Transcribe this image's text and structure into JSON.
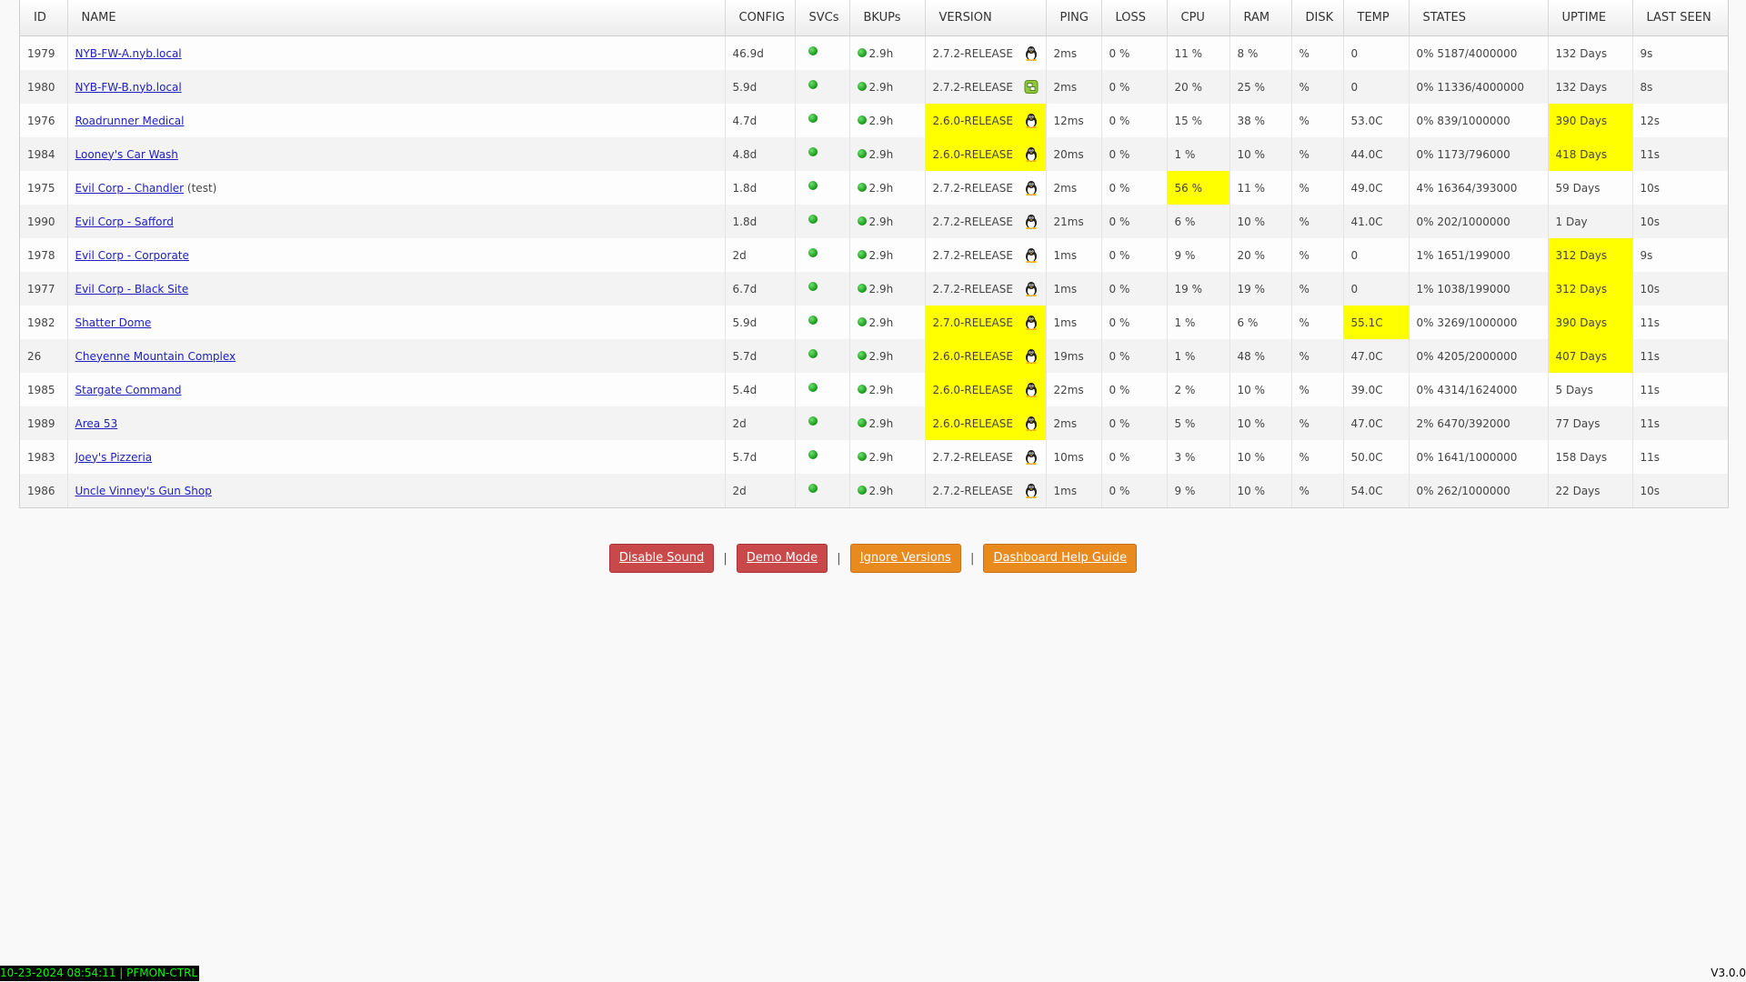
{
  "columns": [
    "ID",
    "NAME",
    "CONFIG",
    "SVCs",
    "BKUPs",
    "VERSION",
    "PING",
    "LOSS",
    "CPU",
    "RAM",
    "DISK",
    "TEMP",
    "STATES",
    "UPTIME",
    "LAST SEEN"
  ],
  "rows": [
    {
      "id": "1979",
      "name": "NYB-FW-A.nyb.local",
      "note": "",
      "config": "46.9d",
      "bkup": "2.9h",
      "version": "2.7.2-RELEASE",
      "os_icon": "tux-icon",
      "ping": "2ms",
      "loss": "0 %",
      "cpu": "11 %",
      "ram": "8 %",
      "disk": "%",
      "temp": "0",
      "states": "0% 5187/4000000",
      "uptime": "132 Days",
      "last_seen": "9s",
      "hl": {
        "version": false,
        "cpu": false,
        "temp": false,
        "uptime": false
      }
    },
    {
      "id": "1980",
      "name": "NYB-FW-B.nyb.local",
      "note": "",
      "config": "5.9d",
      "bkup": "2.9h",
      "version": "2.7.2-RELEASE",
      "os_icon": "failover-icon",
      "ping": "2ms",
      "loss": "0 %",
      "cpu": "20 %",
      "ram": "25 %",
      "disk": "%",
      "temp": "0",
      "states": "0% 11336/4000000",
      "uptime": "132 Days",
      "last_seen": "8s",
      "hl": {
        "version": false,
        "cpu": false,
        "temp": false,
        "uptime": false
      }
    },
    {
      "id": "1976",
      "name": "Roadrunner Medical",
      "note": "",
      "config": "4.7d",
      "bkup": "2.9h",
      "version": "2.6.0-RELEASE",
      "os_icon": "tux-icon",
      "ping": "12ms",
      "loss": "0 %",
      "cpu": "15 %",
      "ram": "38 %",
      "disk": "%",
      "temp": "53.0C",
      "states": "0% 839/1000000",
      "uptime": "390 Days",
      "last_seen": "12s",
      "hl": {
        "version": true,
        "cpu": false,
        "temp": false,
        "uptime": true
      }
    },
    {
      "id": "1984",
      "name": "Looney's Car Wash",
      "note": "",
      "config": "4.8d",
      "bkup": "2.9h",
      "version": "2.6.0-RELEASE",
      "os_icon": "tux-icon",
      "ping": "20ms",
      "loss": "0 %",
      "cpu": "1 %",
      "ram": "10 %",
      "disk": "%",
      "temp": "44.0C",
      "states": "0% 1173/796000",
      "uptime": "418 Days",
      "last_seen": "11s",
      "hl": {
        "version": true,
        "cpu": false,
        "temp": false,
        "uptime": true
      }
    },
    {
      "id": "1975",
      "name": "Evil Corp - Chandler",
      "note": " (test)",
      "config": "1.8d",
      "bkup": "2.9h",
      "version": "2.7.2-RELEASE",
      "os_icon": "tux-icon",
      "ping": "2ms",
      "loss": "0 %",
      "cpu": "56 %",
      "ram": "11 %",
      "disk": "%",
      "temp": "49.0C",
      "states": "4% 16364/393000",
      "uptime": "59 Days",
      "last_seen": "10s",
      "hl": {
        "version": false,
        "cpu": true,
        "temp": false,
        "uptime": false
      }
    },
    {
      "id": "1990",
      "name": "Evil Corp - Safford",
      "note": "",
      "config": "1.8d",
      "bkup": "2.9h",
      "version": "2.7.2-RELEASE",
      "os_icon": "tux-icon",
      "ping": "21ms",
      "loss": "0 %",
      "cpu": "6 %",
      "ram": "10 %",
      "disk": "%",
      "temp": "41.0C",
      "states": "0% 202/1000000",
      "uptime": "1 Day",
      "last_seen": "10s",
      "hl": {
        "version": false,
        "cpu": false,
        "temp": false,
        "uptime": false
      }
    },
    {
      "id": "1978",
      "name": "Evil Corp - Corporate",
      "note": "",
      "config": "2d",
      "bkup": "2.9h",
      "version": "2.7.2-RELEASE",
      "os_icon": "tux-icon",
      "ping": "1ms",
      "loss": "0 %",
      "cpu": "9 %",
      "ram": "20 %",
      "disk": "%",
      "temp": "0",
      "states": "1% 1651/199000",
      "uptime": "312 Days",
      "last_seen": "9s",
      "hl": {
        "version": false,
        "cpu": false,
        "temp": false,
        "uptime": true
      }
    },
    {
      "id": "1977",
      "name": "Evil Corp - Black Site",
      "note": "",
      "config": "6.7d",
      "bkup": "2.9h",
      "version": "2.7.2-RELEASE",
      "os_icon": "tux-icon",
      "ping": "1ms",
      "loss": "0 %",
      "cpu": "19 %",
      "ram": "19 %",
      "disk": "%",
      "temp": "0",
      "states": "1% 1038/199000",
      "uptime": "312 Days",
      "last_seen": "10s",
      "hl": {
        "version": false,
        "cpu": false,
        "temp": false,
        "uptime": true
      }
    },
    {
      "id": "1982",
      "name": "Shatter Dome",
      "note": "",
      "config": "5.9d",
      "bkup": "2.9h",
      "version": "2.7.0-RELEASE",
      "os_icon": "tux-icon",
      "ping": "1ms",
      "loss": "0 %",
      "cpu": "1 %",
      "ram": "6 %",
      "disk": "%",
      "temp": "55.1C",
      "states": "0% 3269/1000000",
      "uptime": "390 Days",
      "last_seen": "11s",
      "hl": {
        "version": true,
        "cpu": false,
        "temp": true,
        "uptime": true
      }
    },
    {
      "id": "26",
      "name": "Cheyenne Mountain Complex",
      "note": "",
      "config": "5.7d",
      "bkup": "2.9h",
      "version": "2.6.0-RELEASE",
      "os_icon": "tux-icon",
      "ping": "19ms",
      "loss": "0 %",
      "cpu": "1 %",
      "ram": "48 %",
      "disk": "%",
      "temp": "47.0C",
      "states": "0% 4205/2000000",
      "uptime": "407 Days",
      "last_seen": "11s",
      "hl": {
        "version": true,
        "cpu": false,
        "temp": false,
        "uptime": true
      }
    },
    {
      "id": "1985",
      "name": "Stargate Command",
      "note": "",
      "config": "5.4d",
      "bkup": "2.9h",
      "version": "2.6.0-RELEASE",
      "os_icon": "tux-icon",
      "ping": "22ms",
      "loss": "0 %",
      "cpu": "2 %",
      "ram": "10 %",
      "disk": "%",
      "temp": "39.0C",
      "states": "0% 4314/1624000",
      "uptime": "5 Days",
      "last_seen": "11s",
      "hl": {
        "version": true,
        "cpu": false,
        "temp": false,
        "uptime": false
      }
    },
    {
      "id": "1989",
      "name": "Area 53",
      "note": "",
      "config": "2d",
      "bkup": "2.9h",
      "version": "2.6.0-RELEASE",
      "os_icon": "tux-icon",
      "ping": "2ms",
      "loss": "0 %",
      "cpu": "5 %",
      "ram": "10 %",
      "disk": "%",
      "temp": "47.0C",
      "states": "2% 6470/392000",
      "uptime": "77 Days",
      "last_seen": "11s",
      "hl": {
        "version": true,
        "cpu": false,
        "temp": false,
        "uptime": false
      }
    },
    {
      "id": "1983",
      "name": "Joey's Pizzeria",
      "note": "",
      "config": "5.7d",
      "bkup": "2.9h",
      "version": "2.7.2-RELEASE",
      "os_icon": "tux-icon",
      "ping": "10ms",
      "loss": "0 %",
      "cpu": "3 %",
      "ram": "10 %",
      "disk": "%",
      "temp": "50.0C",
      "states": "0% 1641/1000000",
      "uptime": "158 Days",
      "last_seen": "11s",
      "hl": {
        "version": false,
        "cpu": false,
        "temp": false,
        "uptime": false
      }
    },
    {
      "id": "1986",
      "name": "Uncle Vinney's Gun Shop",
      "note": "",
      "config": "2d",
      "bkup": "2.9h",
      "version": "2.7.2-RELEASE",
      "os_icon": "tux-icon",
      "ping": "1ms",
      "loss": "0 %",
      "cpu": "9 %",
      "ram": "10 %",
      "disk": "%",
      "temp": "54.0C",
      "states": "0% 262/1000000",
      "uptime": "22 Days",
      "last_seen": "10s",
      "hl": {
        "version": false,
        "cpu": false,
        "temp": false,
        "uptime": false
      }
    }
  ],
  "svc_status_icon": "green-status-dot-icon",
  "highlight_color": "#ffff00",
  "buttons": {
    "disable_sound": "Disable Sound",
    "demo_mode": "Demo Mode",
    "ignore_versions": "Ignore Versions",
    "help_guide": "Dashboard Help Guide",
    "separator": "|"
  },
  "footer": {
    "status": "10-23-2024 08:54:11 | PFMON-CTRL",
    "version": "V3.0.0"
  },
  "colors": {
    "status_green": "#22aa22",
    "button_red": "#c9484a",
    "button_orange": "#e98a1f",
    "footer_text": "#00ff00",
    "footer_bg": "#000000",
    "link": "#2020c0"
  }
}
